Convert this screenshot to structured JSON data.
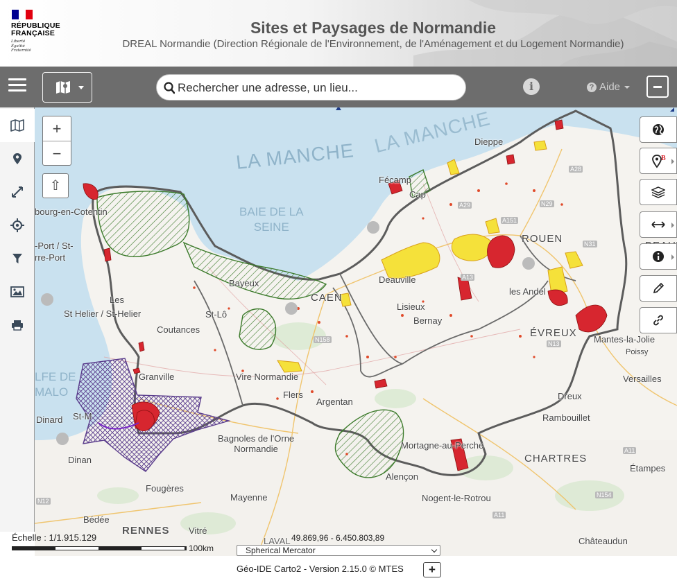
{
  "header": {
    "logo_lines": [
      "RÉPUBLIQUE",
      "FRANÇAISE"
    ],
    "motto_lines": [
      "Liberté",
      "Égalité",
      "Fraternité"
    ],
    "title": "Sites et Paysages de Normandie",
    "subtitle": "DREAL Normandie (Direction Régionale de l'Environnement, de l'Aménagement et du Logement Normandie)"
  },
  "toolbar": {
    "search_placeholder": "Rechercher une adresse, un lieu...",
    "help_label": "Aide",
    "icons": [
      "hamburger-icon",
      "map-icon",
      "search-icon",
      "info-icon",
      "question-icon",
      "minus-icon"
    ]
  },
  "sidebar": {
    "items": [
      "map-icon",
      "location-pin-icon",
      "expand-icon",
      "crosshair-icon",
      "filter-icon",
      "image-icon",
      "print-icon"
    ]
  },
  "map": {
    "zoom_in": "+",
    "zoom_out": "−",
    "extent": "⇧",
    "seas": {
      "manche_1": "LA MANCHE",
      "manche_2": "LA MANCHE",
      "baie": [
        "BAIE DE LA",
        "SEINE"
      ],
      "golfe": [
        "LFE DE",
        "MALO"
      ]
    },
    "cities": {
      "cherbourg": "bourg-en-Cotentin",
      "port": "-Port / St-",
      "pierre": "rre-Port",
      "les": "Les",
      "sthelier": "St Helier / St-Helier",
      "coutances": "Coutances",
      "granville": "Granville",
      "dinard": "Dinard",
      "stmalo": "St-M",
      "dinan": "Dinan",
      "fougeres": "Fougères",
      "bedee": "Bédée",
      "rennes": "RENNES",
      "vitre": "Vitré",
      "laval": "LAVAL",
      "mayenne": "Mayenne",
      "bagnoles": [
        "Bagnoles de l'Orne",
        "Normandie"
      ],
      "flers": "Flers",
      "argentan": "Argentan",
      "vire": "Vire Normandie",
      "stlo": "St-Lô",
      "bayeux": "Bayeux",
      "caen": "CAEN",
      "lisieux": "Lisieux",
      "bernay": "Bernay",
      "deauville": "Deauville",
      "fecamp": "Fécamp",
      "dieppe": "Dieppe",
      "rouen": "ROUEN",
      "beauv": "BEAUV",
      "lesandelys": "les Andel",
      "evreux": "ÉVREUX",
      "mantes": "Mantes-la-Jolie",
      "poissy": "Poissy",
      "versailles": "Versailles",
      "dreux": "Dreux",
      "rambouillet": "Rambouillet",
      "chartres": "CHARTRES",
      "mortagne": "Mortagne-au-Perche",
      "alencon": "Alençon",
      "nogent": "Nogent-le-Rotrou",
      "chateaudun": "Châteaudun",
      "etampes": "Étampes",
      "fecamp_cap": "Cap"
    },
    "roads": [
      "A28",
      "A29",
      "N29",
      "A151",
      "N31",
      "A13",
      "N158",
      "N13",
      "N12",
      "A11",
      "N154",
      "A11"
    ]
  },
  "right_tools": [
    "globe-icon",
    "bookmark-pin-icon",
    "layers-icon",
    "measure-icon",
    "info-icon",
    "pencil-icon",
    "link-icon"
  ],
  "status": {
    "scale": "Échelle : 1/1.915.129",
    "scale_unit": "100km",
    "coordinates": "49.869,96 - 6.450.803,89",
    "projection": "Spherical Mercator",
    "version": "Géo-IDE Carto2 - Version 2.15.0 © MTES",
    "plus": "+"
  },
  "colors": {
    "toolbar": "#6d6d6d",
    "sea": "#c9e1ef",
    "site_red": "#d7262f",
    "site_yellow": "#f5e13a",
    "hatch_green": "#3b7a2a",
    "hatch_purple": "#5a3c8c",
    "boundary": "#555555"
  }
}
